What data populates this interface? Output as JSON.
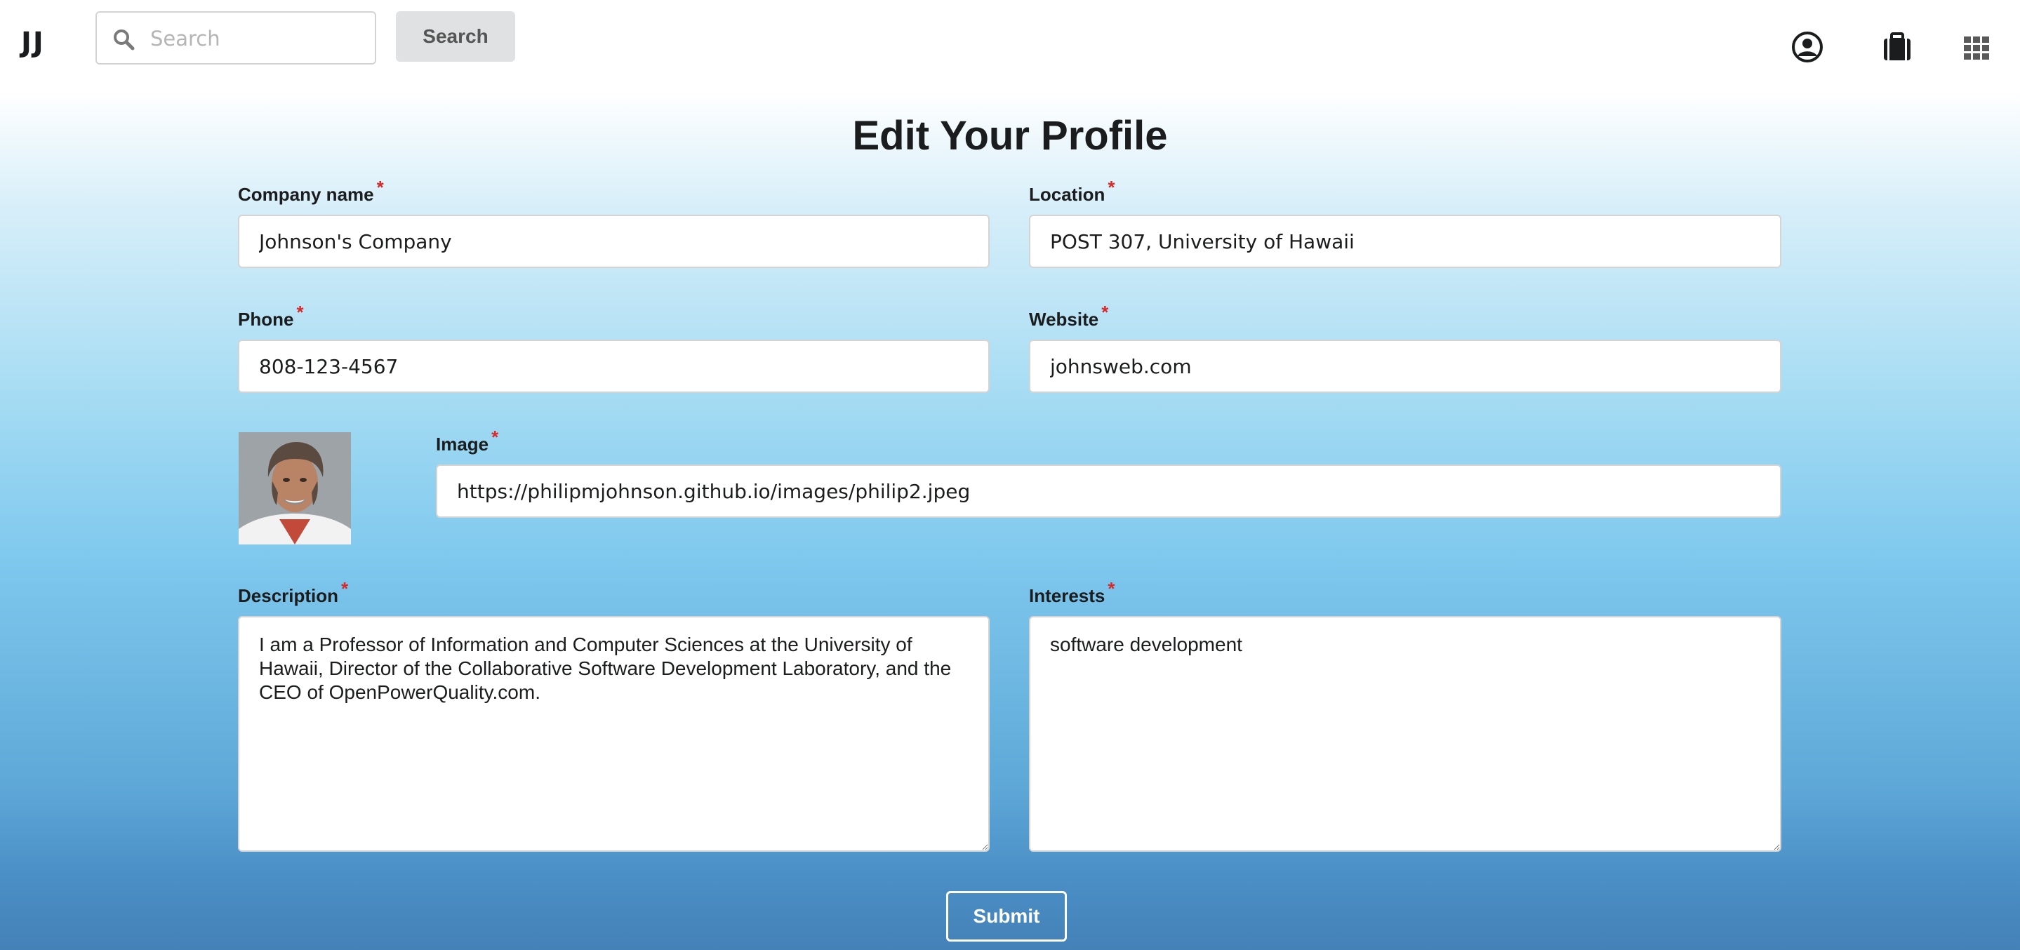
{
  "nav": {
    "logo": "JJ",
    "search_placeholder": "Search",
    "search_button": "Search",
    "icons": [
      "user-circle-icon",
      "briefcase-icon",
      "apps-grid-icon"
    ]
  },
  "page": {
    "title": "Edit Your Profile"
  },
  "form": {
    "required_marker": "*",
    "company_name": {
      "label": "Company name",
      "value": "Johnson's Company"
    },
    "location": {
      "label": "Location",
      "value": "POST 307, University of Hawaii"
    },
    "phone": {
      "label": "Phone",
      "value": "808-123-4567"
    },
    "website": {
      "label": "Website",
      "value": "johnsweb.com"
    },
    "image": {
      "label": "Image",
      "value": "https://philipmjohnson.github.io/images/philip2.jpeg"
    },
    "description": {
      "label": "Description",
      "value": "I am a Professor of Information and Computer Sciences at the University of Hawaii, Director of the Collaborative Software Development Laboratory, and the CEO of OpenPowerQuality.com."
    },
    "interests": {
      "label": "Interests",
      "value": "software development"
    },
    "submit_label": "Submit"
  },
  "colors": {
    "required": "#db2828",
    "input_border": "#d4d4d5",
    "gradient_top": "#ffffff",
    "gradient_bottom": "#4481b8"
  }
}
